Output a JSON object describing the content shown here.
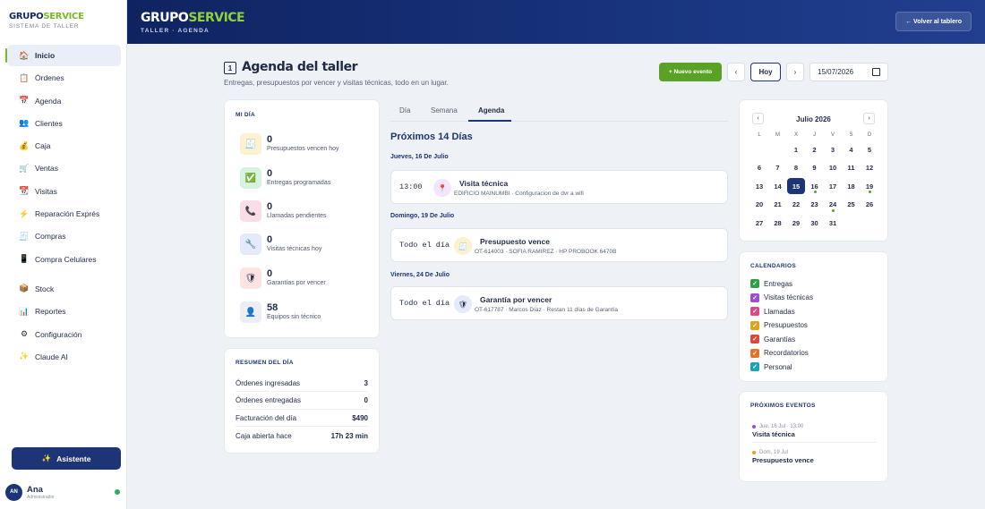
{
  "brand": {
    "name_a": "GRUPO",
    "name_b": "SERVICE",
    "subtitle": "SISTEMA DE TALLER"
  },
  "sidebar": {
    "items": [
      {
        "label": "Inicio",
        "icon": "home-icon",
        "glyph": "🏠",
        "active": true
      },
      {
        "label": "Órdenes",
        "icon": "clipboard-icon",
        "glyph": "📋"
      },
      {
        "label": "Agenda",
        "icon": "calendar-icon",
        "glyph": "📅"
      },
      {
        "label": "Clientes",
        "icon": "users-icon",
        "glyph": "👥"
      },
      {
        "label": "Caja",
        "icon": "money-bag-icon",
        "glyph": "💰"
      },
      {
        "label": "Ventas",
        "icon": "cart-icon",
        "glyph": "🛒"
      },
      {
        "label": "Visitas",
        "icon": "calendar-grid-icon",
        "glyph": "📆"
      },
      {
        "label": "Reparación Exprés",
        "icon": "lightning-icon",
        "glyph": "⚡"
      },
      {
        "label": "Compras",
        "icon": "receipt-icon",
        "glyph": "🧾"
      },
      {
        "label": "Compra Celulares",
        "icon": "phone-icon",
        "glyph": "📱"
      },
      {
        "label": "Stock",
        "icon": "box-icon",
        "glyph": "📦"
      },
      {
        "label": "Reportes",
        "icon": "bar-chart-icon",
        "glyph": "📊"
      },
      {
        "label": "Configuración",
        "icon": "gear-icon",
        "glyph": "⚙"
      },
      {
        "label": "Claude AI",
        "icon": "sparkle-icon",
        "glyph": "✨"
      }
    ],
    "assistant_label": "Asistente",
    "assistant_glyph": "✨"
  },
  "user": {
    "initials": "AN",
    "name": "Ana",
    "role": "Administrador",
    "status_color": "#27b35a"
  },
  "topbar": {
    "title_a": "GRUPO",
    "title_b": "SERVICE",
    "subtitle": "TALLER · AGENDA",
    "back_label": "← Volver al tablero"
  },
  "page": {
    "icon_glyph": "1",
    "title": "Agenda del taller",
    "subtitle": "Entregas, presupuestos por vencer y visitas técnicas, todo en un lugar."
  },
  "toolbar": {
    "new_event": "+ Nuevo evento",
    "prev": "‹",
    "today": "Hoy",
    "next": "›",
    "date": "15/07/2026"
  },
  "mi_dia": {
    "title": "MI DÍA",
    "stats": [
      {
        "value": "0",
        "label": "Presupuestos vencen hoy",
        "glyph": "🧾",
        "bg": "#fdf1cf",
        "icon": "receipt-icon"
      },
      {
        "value": "0",
        "label": "Entregas programadas",
        "glyph": "✅",
        "bg": "#d9f2df",
        "icon": "check-icon"
      },
      {
        "value": "0",
        "label": "Llamadas pendientes",
        "glyph": "📞",
        "bg": "#fbdde9",
        "icon": "phone-call-icon"
      },
      {
        "value": "0",
        "label": "Visitas técnicas hoy",
        "glyph": "🔧",
        "bg": "#e4e9fb",
        "icon": "wrench-icon"
      },
      {
        "value": "0",
        "label": "Garantías por vencer",
        "glyph": "🛡",
        "bg": "#fde4e2",
        "icon": "shield-icon"
      },
      {
        "value": "58",
        "label": "Equipos sin técnico",
        "glyph": "👤",
        "bg": "#eceef3",
        "icon": "person-icon"
      }
    ]
  },
  "resumen": {
    "title": "RESUMEN DEL DÍA",
    "rows": [
      {
        "label": "Órdenes ingresadas",
        "value": "3"
      },
      {
        "label": "Órdenes entregadas",
        "value": "0"
      },
      {
        "label": "Facturación del día",
        "value": "$490"
      },
      {
        "label": "Caja abierta hace",
        "value": "17h 23 min"
      }
    ]
  },
  "tabs": [
    {
      "label": "Día"
    },
    {
      "label": "Semana"
    },
    {
      "label": "Agenda",
      "active": true
    }
  ],
  "agenda": {
    "heading": "Próximos 14 Días",
    "days": [
      {
        "date": "Jueves, 16 De Julio",
        "event": {
          "time": "13:00",
          "title": "Visita técnica",
          "detail": "EDIFICIO MAINUMBI · Configuracion de dvr a wifi",
          "glyph": "📍",
          "bg": "#f5e5fb",
          "title_color": "#1f2a44",
          "icon": "pin-icon"
        }
      },
      {
        "date": "Domingo, 19 De Julio",
        "event": {
          "time": "Todo el día",
          "title": "Presupuesto vence",
          "detail": "OT-614003 · SOFIA RAMIREZ · HP PROBOOK 6470B",
          "glyph": "🧾",
          "bg": "#fdf1cf",
          "title_color": "#1f2a44",
          "icon": "receipt-icon"
        }
      },
      {
        "date": "Viernes, 24 De Julio",
        "event": {
          "time": "Todo el día",
          "title": "Garantía por vencer",
          "detail": "OT-617787 · Marcos Díaz · Restan 11 días de Garantía",
          "glyph": "🛡",
          "bg": "#e4e9fb",
          "title_color": "#1f2a44",
          "icon": "shield-icon"
        }
      }
    ]
  },
  "mini_calendar": {
    "month": "Julio 2026",
    "prev": "‹",
    "next": "›",
    "dow": [
      "L",
      "M",
      "X",
      "J",
      "V",
      "S",
      "D"
    ],
    "weeks": [
      [
        "",
        "",
        "1",
        "2",
        "3",
        "4",
        "5"
      ],
      [
        "6",
        "7",
        "8",
        "9",
        "10",
        "11",
        "12"
      ],
      [
        "13",
        "14",
        "15",
        "16",
        "17",
        "18",
        "19"
      ],
      [
        "20",
        "21",
        "22",
        "23",
        "24",
        "25",
        "26"
      ],
      [
        "27",
        "28",
        "29",
        "30",
        "31",
        "",
        ""
      ]
    ],
    "selected": "15",
    "dots": {
      "16": "#5aa226",
      "19": "#5aa226",
      "24": "#5aa226"
    }
  },
  "calendarios": {
    "title": "CALENDARIOS",
    "items": [
      {
        "label": "Entregas",
        "color": "#2e9e4a"
      },
      {
        "label": "Visitas técnicas",
        "color": "#9a4fd1"
      },
      {
        "label": "Llamadas",
        "color": "#d94a86"
      },
      {
        "label": "Presupuestos",
        "color": "#e0a21a"
      },
      {
        "label": "Garantías",
        "color": "#d9483b"
      },
      {
        "label": "Recordatorios",
        "color": "#e0742a"
      },
      {
        "label": "Personal",
        "color": "#1ea2b5"
      }
    ]
  },
  "proximos": {
    "title": "PRÓXIMOS EVENTOS",
    "items": [
      {
        "meta": "Jue, 16 Jul · 13:00",
        "title": "Visita técnica",
        "color": "#9a4fd1"
      },
      {
        "meta": "Dom, 19 Jul",
        "title": "Presupuesto vence",
        "color": "#e0a21a"
      }
    ]
  }
}
